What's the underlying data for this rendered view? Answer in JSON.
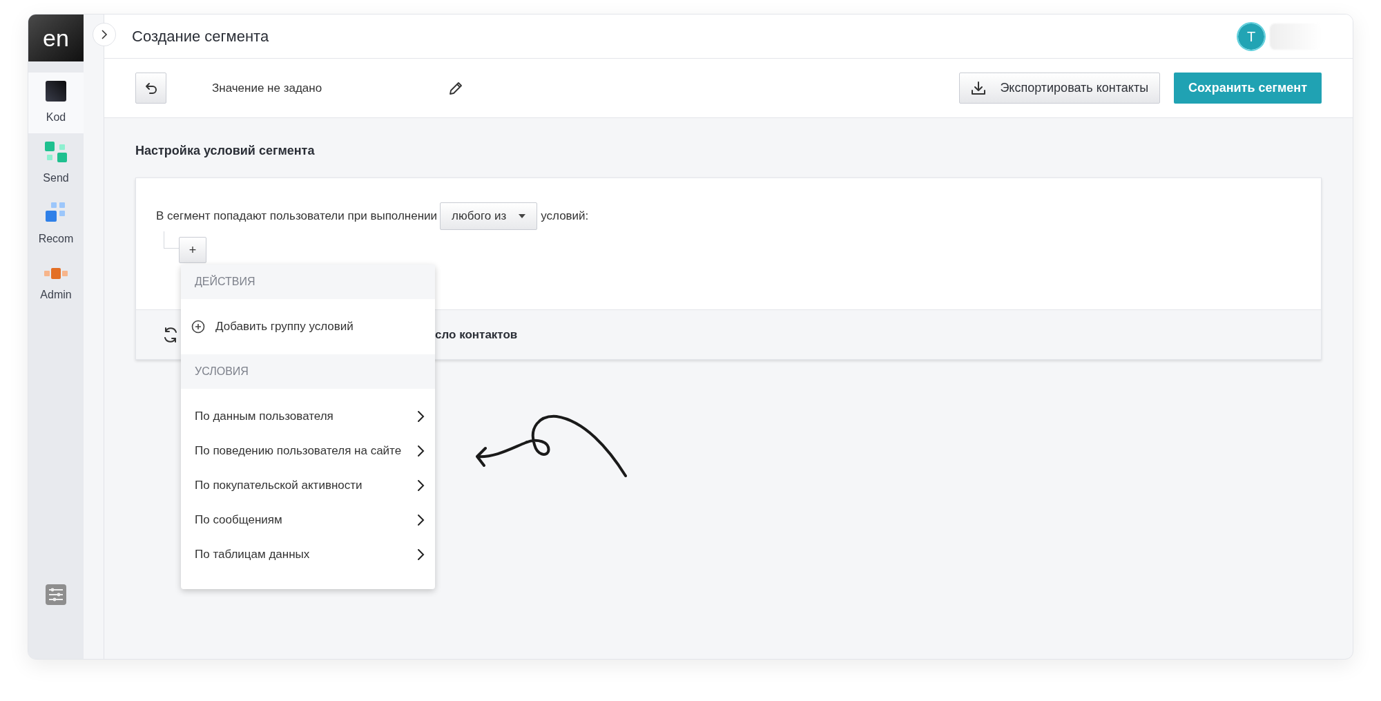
{
  "sidebar": {
    "logo": "en",
    "items": [
      {
        "label": "Kod",
        "kind": "kod",
        "selected": true
      },
      {
        "label": "Send",
        "kind": "send",
        "selected": false
      },
      {
        "label": "Recom",
        "kind": "recom",
        "selected": false
      },
      {
        "label": "Admin",
        "kind": "admin",
        "selected": false
      }
    ]
  },
  "header": {
    "title": "Создание сегмента",
    "avatar": "T"
  },
  "toolbar": {
    "name_value": "Значение не задано",
    "buttons": [
      {
        "label": "Экспортировать контакты",
        "kind": "secondary"
      },
      {
        "label": "Сохранить сегмент",
        "kind": "primary"
      }
    ]
  },
  "section_title": "Настройка условий сегмента",
  "conditions": {
    "sentence_start": "В сегмент попадают пользователи при выполнении",
    "match_select": "любого из",
    "sentence_end": "условий:",
    "add_button": "+"
  },
  "count_bar": {
    "text": "сло контактов"
  },
  "menu": {
    "sections": [
      {
        "title": "ДЕЙСТВИЯ",
        "items": [
          {
            "label": "Добавить группу условий",
            "kind": "action"
          }
        ]
      },
      {
        "title": "УСЛОВИЯ",
        "items": [
          {
            "label": "По данным пользователя",
            "kind": "submenu"
          },
          {
            "label": "По поведению пользователя на сайте",
            "kind": "submenu"
          },
          {
            "label": "По покупательской активности",
            "kind": "submenu"
          },
          {
            "label": "По сообщениям",
            "kind": "submenu"
          },
          {
            "label": "По таблицам данных",
            "kind": "submenu"
          }
        ]
      }
    ]
  }
}
